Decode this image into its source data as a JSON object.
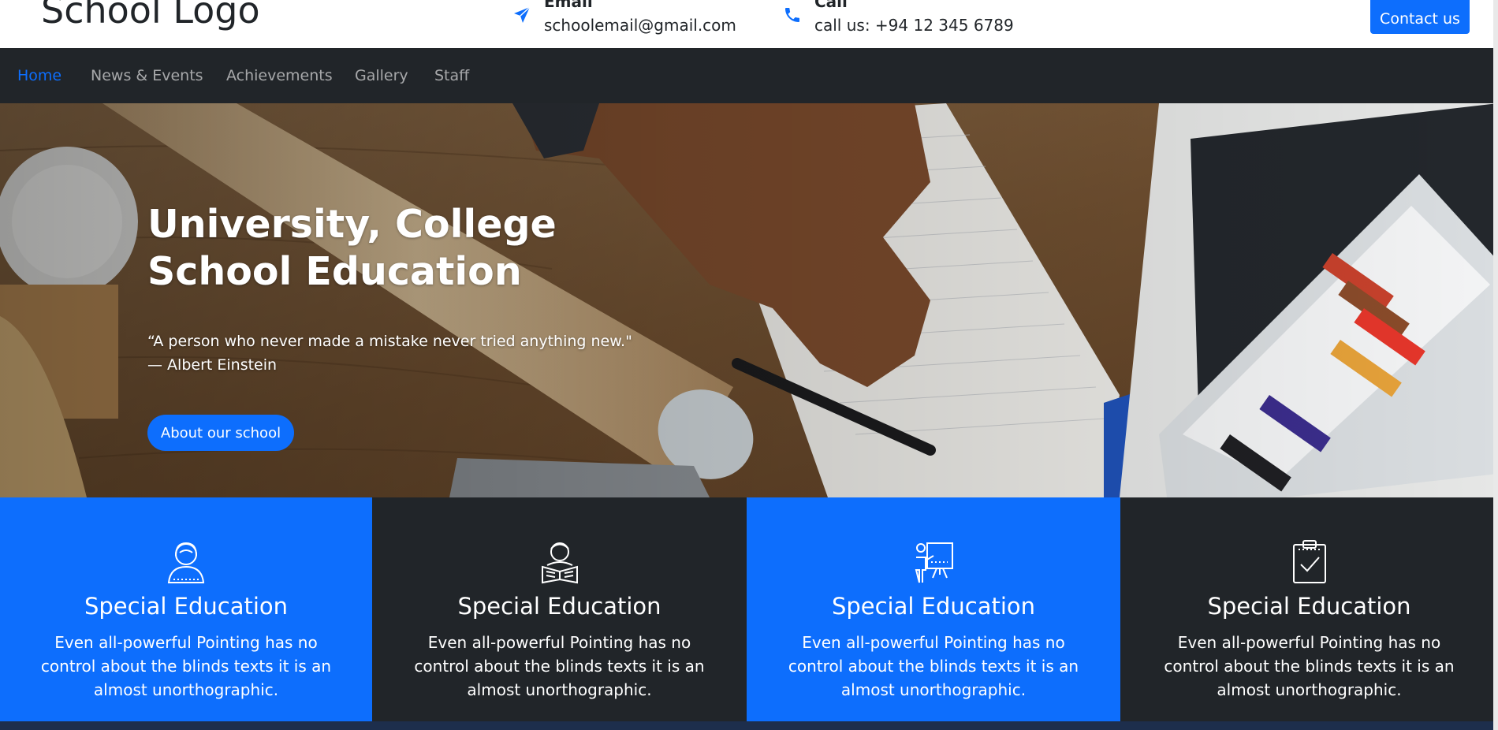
{
  "header": {
    "logo": "School Logo",
    "email_label": "Email",
    "email_value": "schoolemail@gmail.com",
    "call_label": "Call",
    "call_value": "call us: +94 12 345 6789",
    "contact_button": "Contact us",
    "email_icon": "paper-plane-icon",
    "call_icon": "phone-icon"
  },
  "nav": {
    "items": [
      {
        "label": "Home",
        "active": true
      },
      {
        "label": "News & Events"
      },
      {
        "label": "Achievements"
      },
      {
        "label": "Gallery"
      },
      {
        "label": "Staff"
      }
    ]
  },
  "hero": {
    "title_line1": "University, College",
    "title_line2": "School Education",
    "quote_line1": "“A person who never made a mistake never tried anything new.\"",
    "quote_line2": "— Albert Einstein",
    "button": "About our school"
  },
  "features": [
    {
      "icon": "female-student-icon",
      "title": "Special Education",
      "text": "Even all-powerful Pointing has no control about the blinds texts it is an almost unorthographic."
    },
    {
      "icon": "student-reading-icon",
      "title": "Special Education",
      "text": "Even all-powerful Pointing has no control about the blinds texts it is an almost unorthographic."
    },
    {
      "icon": "teacher-board-icon",
      "title": "Special Education",
      "text": "Even all-powerful Pointing has no control about the blinds texts it is an almost unorthographic."
    },
    {
      "icon": "clipboard-check-icon",
      "title": "Special Education",
      "text": "Even all-powerful Pointing has no control about the blinds texts it is an almost unorthographic."
    }
  ],
  "colors": {
    "primary": "#0d6efd",
    "dark": "#212529",
    "white": "#ffffff"
  }
}
